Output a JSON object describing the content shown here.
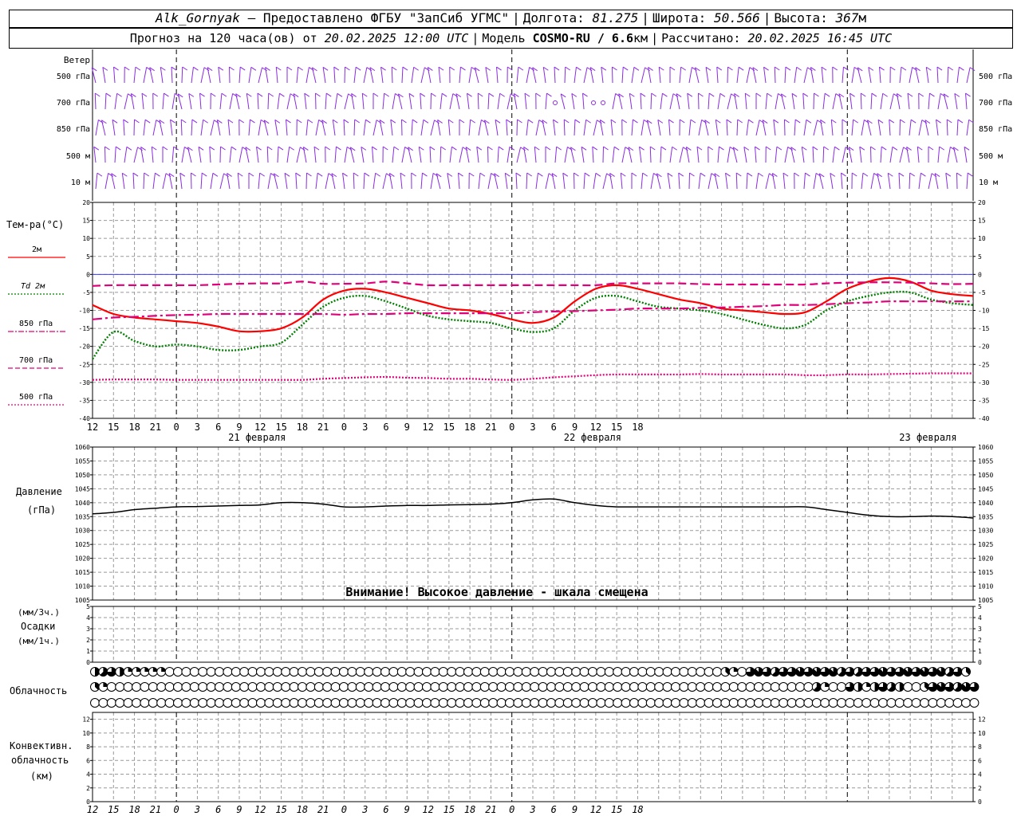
{
  "header": {
    "station": "Alk_Gornyak",
    "provider": "— Предоставлено ФГБУ \"ЗапСиб УГМС\"",
    "lon_label": "Долгота:",
    "lon_value": "81.275",
    "lat_label": "Широта:",
    "lat_value": "50.566",
    "alt_label": "Высота:",
    "alt_value": "367",
    "alt_unit": "м",
    "forecast_text": "Прогноз на 120 часа(ов) от",
    "forecast_from": "20.02.2025 12:00 UTC",
    "model_label": "Модель",
    "model_name": "COSMO-RU / 6.6",
    "model_unit": "км",
    "calc_label": "Рассчитано:",
    "calc_time": "20.02.2025 16:45 UTC"
  },
  "wind_panel": {
    "title": "Ветер",
    "levels": [
      "500 гПа",
      "700 гПа",
      "850 гПа",
      "500 м",
      "10  м"
    ],
    "barb_color": "#8a2be2"
  },
  "time_axis": {
    "hour_labels": [
      "12",
      "15",
      "18",
      "21",
      "0",
      "3",
      "6",
      "9",
      "12",
      "15",
      "18",
      "21",
      "0",
      "3",
      "6",
      "9",
      "12",
      "15",
      "18",
      "21",
      "0",
      "3",
      "6",
      "9",
      "12",
      "15",
      "18"
    ],
    "day_labels": [
      "21 февраля",
      "22 февраля",
      "23 февраля"
    ]
  },
  "temperature_panel": {
    "title": "Тем-ра(°C)",
    "legend": [
      {
        "label": "2м",
        "color": "#ff0000",
        "style": "solid"
      },
      {
        "label": "Td  2м",
        "color": "#008000",
        "style": "dotted"
      },
      {
        "label": "850 гПа",
        "color": "#e0007a",
        "style": "dash-dot"
      },
      {
        "label": "700 гПа",
        "color": "#e0007a",
        "style": "dash"
      },
      {
        "label": "500 гПа",
        "color": "#e0007a",
        "style": "dotted"
      }
    ],
    "y_ticks": [
      "20",
      "15",
      "10",
      "5",
      "0",
      "-5",
      "-10",
      "-15",
      "-20",
      "-25",
      "-30",
      "-35",
      "-40"
    ]
  },
  "pressure_panel": {
    "title_line1": "Давление",
    "title_line2": "(гПа)",
    "y_ticks": [
      "1060",
      "1055",
      "1050",
      "1045",
      "1040",
      "1035",
      "1030",
      "1025",
      "1020",
      "1015",
      "1010",
      "1005"
    ],
    "warning": "Внимание! Высокое давление - шкала смещена"
  },
  "precip_panel": {
    "label_line1": "(мм/3ч.)",
    "label_line2": "Осадки",
    "label_line3": "(мм/1ч.)",
    "y_ticks": [
      "5",
      "4",
      "3",
      "2",
      "1",
      "0"
    ]
  },
  "cloud_panel": {
    "title": "Облачность",
    "rows": [
      [
        4,
        5,
        6,
        4,
        2,
        2,
        2,
        2,
        2,
        0,
        0,
        0,
        0,
        0,
        0,
        0,
        0,
        0,
        0,
        0,
        0,
        0,
        0,
        0,
        0,
        0,
        0,
        0,
        0,
        0,
        0,
        0,
        0,
        0,
        0,
        0,
        0,
        0,
        0,
        0,
        0,
        0,
        0,
        0,
        0,
        0,
        0,
        0,
        0,
        0,
        0,
        0,
        0,
        0,
        0,
        0,
        0,
        0,
        0,
        0,
        0,
        0,
        0,
        0,
        0,
        0,
        0,
        0,
        0,
        0,
        0,
        0,
        0,
        0,
        0,
        0,
        3,
        2,
        0,
        6,
        7,
        6,
        5,
        6,
        6,
        7,
        6,
        7,
        6,
        7,
        5,
        6,
        5,
        6,
        6,
        7,
        6,
        6,
        7,
        6,
        7,
        6,
        7,
        5,
        6,
        3
      ],
      [
        3,
        2,
        0,
        0,
        0,
        0,
        0,
        0,
        0,
        0,
        0,
        0,
        0,
        0,
        0,
        0,
        0,
        0,
        0,
        0,
        0,
        0,
        0,
        0,
        0,
        0,
        0,
        0,
        0,
        0,
        0,
        0,
        0,
        0,
        0,
        0,
        0,
        0,
        0,
        0,
        0,
        0,
        0,
        0,
        0,
        0,
        0,
        0,
        0,
        0,
        0,
        0,
        0,
        0,
        0,
        0,
        0,
        0,
        0,
        0,
        0,
        0,
        0,
        0,
        0,
        0,
        0,
        0,
        0,
        0,
        0,
        0,
        0,
        0,
        0,
        0,
        0,
        0,
        0,
        0,
        0,
        0,
        0,
        0,
        0,
        0,
        0,
        5,
        2,
        0,
        0,
        6,
        4,
        2,
        4,
        6,
        5,
        4,
        0,
        0,
        3,
        6,
        7,
        6,
        5,
        7,
        6
      ],
      [
        0,
        0,
        0,
        0,
        0,
        0,
        0,
        0,
        0,
        0,
        0,
        0,
        0,
        0,
        0,
        0,
        0,
        0,
        0,
        0,
        0,
        0,
        0,
        0,
        0,
        0,
        0,
        0,
        0,
        0,
        0,
        0,
        0,
        0,
        0,
        0,
        0,
        0,
        0,
        0,
        0,
        0,
        0,
        0,
        0,
        0,
        0,
        0,
        0,
        0,
        0,
        0,
        0,
        0,
        0,
        0,
        0,
        0,
        0,
        0,
        0,
        0,
        0,
        0,
        0,
        0,
        0,
        0,
        0,
        0,
        0,
        0,
        0,
        0,
        0,
        0,
        0,
        0,
        0,
        0,
        0,
        0,
        0,
        0,
        0,
        0,
        0,
        0,
        0,
        0,
        0,
        0,
        0,
        0,
        0,
        0,
        0,
        0,
        0,
        0,
        0,
        0,
        0,
        0,
        0,
        0,
        0
      ]
    ]
  },
  "conv_panel": {
    "title_line1": "Конвективн.",
    "title_line2": "облачность",
    "title_line3": "(км)",
    "y_ticks": [
      "12",
      "10",
      "8",
      "6",
      "4",
      "2",
      "0"
    ]
  },
  "chart_data": [
    {
      "type": "line",
      "panel": "temperature",
      "x_hours": [
        0,
        3,
        6,
        9,
        12,
        15,
        18,
        21,
        24,
        27,
        30,
        33,
        36,
        39,
        42,
        45,
        48,
        51,
        54,
        57,
        60,
        63,
        66,
        69,
        72,
        75,
        78,
        81,
        84,
        87,
        90,
        93,
        96,
        99,
        102,
        105,
        108,
        111,
        114,
        117,
        120,
        123,
        126
      ],
      "ylim": [
        -40,
        20
      ],
      "series": [
        {
          "name": "2м",
          "color": "#ff0000",
          "style": "solid",
          "values": [
            -8.5,
            -11,
            -12,
            -12.5,
            -13,
            -13.5,
            -14.5,
            -15.8,
            -15.8,
            -15,
            -12,
            -7,
            -4.5,
            -4,
            -5,
            -6.5,
            -8,
            -9.5,
            -10,
            -11,
            -12.5,
            -13.5,
            -12,
            -7.5,
            -4,
            -3,
            -4,
            -5.5,
            -7,
            -8,
            -9.5,
            -10,
            -10.5,
            -11,
            -10.5,
            -7.5,
            -4,
            -2,
            -1,
            -2,
            -4.5,
            -5.5,
            -6
          ]
        },
        {
          "name": "Td  2м",
          "color": "#008000",
          "style": "dotted",
          "values": [
            -23.5,
            -16,
            -18.5,
            -20,
            -19.5,
            -20,
            -21,
            -21,
            -20,
            -19,
            -14,
            -9,
            -6.5,
            -6,
            -7.5,
            -9.5,
            -11.5,
            -12.5,
            -13,
            -13.5,
            -15,
            -16,
            -15,
            -10,
            -6.5,
            -6,
            -7.5,
            -9,
            -9.5,
            -10,
            -11,
            -12.5,
            -14,
            -15,
            -14,
            -10,
            -7.5,
            -6,
            -5,
            -5,
            -7,
            -8,
            -8.5
          ]
        },
        {
          "name": "850 гПа",
          "color": "#e0007a",
          "style": "dash-dot",
          "values": [
            -12.5,
            -12,
            -11.8,
            -11.5,
            -11.3,
            -11.2,
            -11,
            -11,
            -11,
            -11,
            -11,
            -11,
            -11.2,
            -11,
            -11,
            -10.8,
            -10.8,
            -10.8,
            -10.8,
            -10.8,
            -10.8,
            -10.5,
            -10.3,
            -10.2,
            -10,
            -9.8,
            -9.5,
            -9.5,
            -9.5,
            -9.3,
            -9.2,
            -9,
            -8.8,
            -8.5,
            -8.5,
            -8.3,
            -8,
            -7.8,
            -7.5,
            -7.5,
            -7.5,
            -7.5,
            -7.5
          ]
        },
        {
          "name": "700 гПа",
          "color": "#e0007a",
          "style": "dash",
          "values": [
            -3.2,
            -3,
            -3,
            -3,
            -3,
            -3,
            -2.8,
            -2.6,
            -2.5,
            -2.5,
            -2,
            -2.6,
            -2.6,
            -2.5,
            -2,
            -2.5,
            -3,
            -3,
            -3,
            -3,
            -3,
            -3,
            -3,
            -3,
            -3,
            -2.5,
            -2.5,
            -2.5,
            -2.5,
            -2.7,
            -2.8,
            -2.8,
            -2.8,
            -2.8,
            -2.8,
            -2.5,
            -2.3,
            -2.2,
            -2.2,
            -2.3,
            -2.5,
            -2.7,
            -2.6
          ]
        },
        {
          "name": "500 гПа",
          "color": "#e0007a",
          "style": "dotted",
          "values": [
            -29.3,
            -29.2,
            -29.2,
            -29.2,
            -29.3,
            -29.3,
            -29.3,
            -29.3,
            -29.3,
            -29.3,
            -29.3,
            -29,
            -28.8,
            -28.6,
            -28.5,
            -28.7,
            -28.8,
            -29,
            -29,
            -29.2,
            -29.3,
            -29,
            -28.6,
            -28.3,
            -28,
            -27.8,
            -27.8,
            -27.8,
            -27.8,
            -27.7,
            -27.8,
            -27.8,
            -27.8,
            -27.8,
            -28,
            -28,
            -27.8,
            -27.8,
            -27.7,
            -27.6,
            -27.5,
            -27.5,
            -27.5
          ]
        }
      ]
    },
    {
      "type": "line",
      "panel": "pressure",
      "x_hours": [
        0,
        3,
        6,
        9,
        12,
        15,
        18,
        21,
        24,
        27,
        30,
        33,
        36,
        39,
        42,
        45,
        48,
        51,
        54,
        57,
        60,
        63,
        66,
        69,
        72,
        75,
        78,
        81,
        84,
        87,
        90,
        93,
        96,
        99,
        102,
        105,
        108,
        111,
        114,
        117,
        120,
        123,
        126
      ],
      "ylim": [
        1005,
        1060
      ],
      "series": [
        {
          "name": "",
          "color": "#000000",
          "style": "solid",
          "values": [
            1036,
            1036.5,
            1037.5,
            1038,
            1038.5,
            1038.6,
            1038.8,
            1039,
            1039.2,
            1040,
            1040,
            1039.5,
            1038.5,
            1038.5,
            1038.8,
            1039,
            1039,
            1039.2,
            1039.3,
            1039.5,
            1040,
            1041,
            1041.3,
            1040,
            1039,
            1038.5,
            1038.5,
            1038.5,
            1038.5,
            1038.5,
            1038.5,
            1038.5,
            1038.5,
            1038.5,
            1038.5,
            1037.5,
            1036.5,
            1035.5,
            1035,
            1035,
            1035.2,
            1035,
            1034.5
          ]
        }
      ]
    }
  ]
}
